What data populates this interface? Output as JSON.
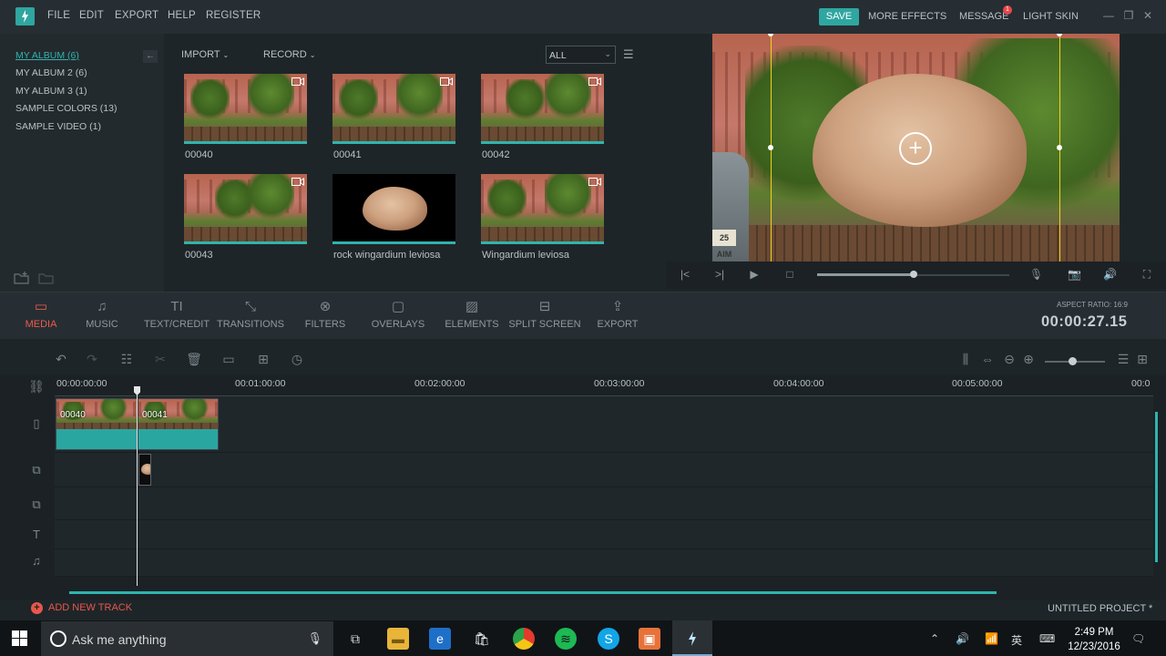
{
  "menu": {
    "items": [
      "FILE",
      "EDIT",
      "EXPORT",
      "HELP",
      "REGISTER"
    ],
    "save_label": "SAVE",
    "more_effects": "MORE EFFECTS",
    "message": "MESSAGE",
    "message_count": "1",
    "light_skin": "LIGHT SKIN"
  },
  "albums": [
    {
      "label": "MY ALBUM (6)",
      "active": true
    },
    {
      "label": "MY ALBUM 2 (6)",
      "active": false
    },
    {
      "label": "MY ALBUM 3 (1)",
      "active": false
    },
    {
      "label": "SAMPLE COLORS (13)",
      "active": false
    },
    {
      "label": "SAMPLE VIDEO (1)",
      "active": false
    }
  ],
  "media_toolbar": {
    "import": "IMPORT",
    "record": "RECORD",
    "filter_value": "ALL"
  },
  "media_items": [
    {
      "label": "00040",
      "kind": "video"
    },
    {
      "label": "00041",
      "kind": "video"
    },
    {
      "label": "00042",
      "kind": "video"
    },
    {
      "label": "00043",
      "kind": "video"
    },
    {
      "label": "rock wingardium leviosa",
      "kind": "image"
    },
    {
      "label": "Wingardium leviosa",
      "kind": "video"
    }
  ],
  "preview": {
    "plate_text": "25 AIM",
    "progress": 0.5
  },
  "tools": [
    {
      "label": "MEDIA",
      "icon": "folder-icon",
      "active": true
    },
    {
      "label": "MUSIC",
      "icon": "music-note-icon",
      "active": false
    },
    {
      "label": "TEXT/CREDIT",
      "icon": "text-icon",
      "active": false
    },
    {
      "label": "TRANSITIONS",
      "icon": "transitions-icon",
      "active": false
    },
    {
      "label": "FILTERS",
      "icon": "filters-icon",
      "active": false
    },
    {
      "label": "OVERLAYS",
      "icon": "overlays-icon",
      "active": false
    },
    {
      "label": "ELEMENTS",
      "icon": "elements-icon",
      "active": false
    },
    {
      "label": "SPLIT SCREEN",
      "icon": "split-screen-icon",
      "active": false
    },
    {
      "label": "EXPORT",
      "icon": "export-icon",
      "active": false
    }
  ],
  "aspect_ratio": "ASPECT RATIO: 16:9",
  "timecode": "00:00:27.15",
  "ruler": [
    "00:00:00:00",
    "00:01:00:00",
    "00:02:00:00",
    "00:03:00:00",
    "00:04:00:00",
    "00:05:00:00",
    "00:0"
  ],
  "clips": [
    {
      "name": "00040"
    },
    {
      "name": "00041"
    }
  ],
  "footer": {
    "add_track": "ADD NEW TRACK",
    "project": "UNTITLED PROJECT *"
  },
  "taskbar": {
    "search_placeholder": "Ask me anything",
    "time": "2:49 PM",
    "date": "12/23/2016"
  },
  "colors": {
    "accent": "#2fb4ad",
    "active_tool": "#ef5a4c",
    "guide": "#f2d21a"
  }
}
